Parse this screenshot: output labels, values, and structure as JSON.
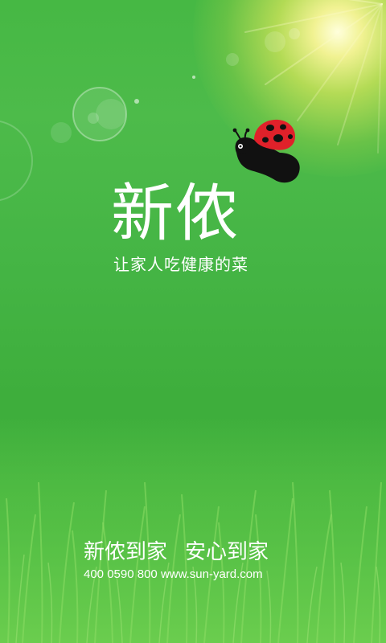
{
  "brand": {
    "name": "新侬",
    "slogan": "让家人吃健康的菜"
  },
  "footer": {
    "slogan_part1": "新侬到家",
    "slogan_part2": "安心到家",
    "phone": "400 0590 800",
    "website": "www.sun-yard.com"
  },
  "icons": {
    "mascot": "ladybug-icon"
  },
  "colors": {
    "background_green": "#46b844",
    "sun_glow": "#f4f08a",
    "text": "#ffffff",
    "ladybug_red": "#e0212a",
    "ladybug_black": "#111111"
  }
}
